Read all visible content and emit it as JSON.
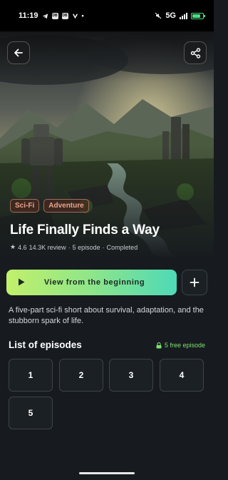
{
  "status_bar": {
    "time": "11:19",
    "network": "5G",
    "notif_a": "DB",
    "notif_b": "DB"
  },
  "header": {
    "back_icon": "arrow-left-icon",
    "share_icon": "share-icon"
  },
  "show": {
    "tags": [
      "Sci-Fi",
      "Adventure"
    ],
    "title": "Life Finally Finds a Way",
    "rating": "4.6",
    "reviews": "14.3K review",
    "episode_count": "5 episode",
    "status": "Completed",
    "description": "A five-part sci-fi short about survival, adaptation, and the stubborn spark of life."
  },
  "actions": {
    "play_label": "View from the beginning",
    "add_icon": "plus-icon"
  },
  "episodes_section": {
    "title": "List of episodes",
    "free_label": "5 free episode",
    "episodes": [
      "1",
      "2",
      "3",
      "4",
      "5"
    ]
  },
  "colors": {
    "tag_text": "#e9a48d",
    "free_green": "#7ee06f",
    "gradient_start": "#c2f06b",
    "gradient_end": "#4fd9b7"
  }
}
